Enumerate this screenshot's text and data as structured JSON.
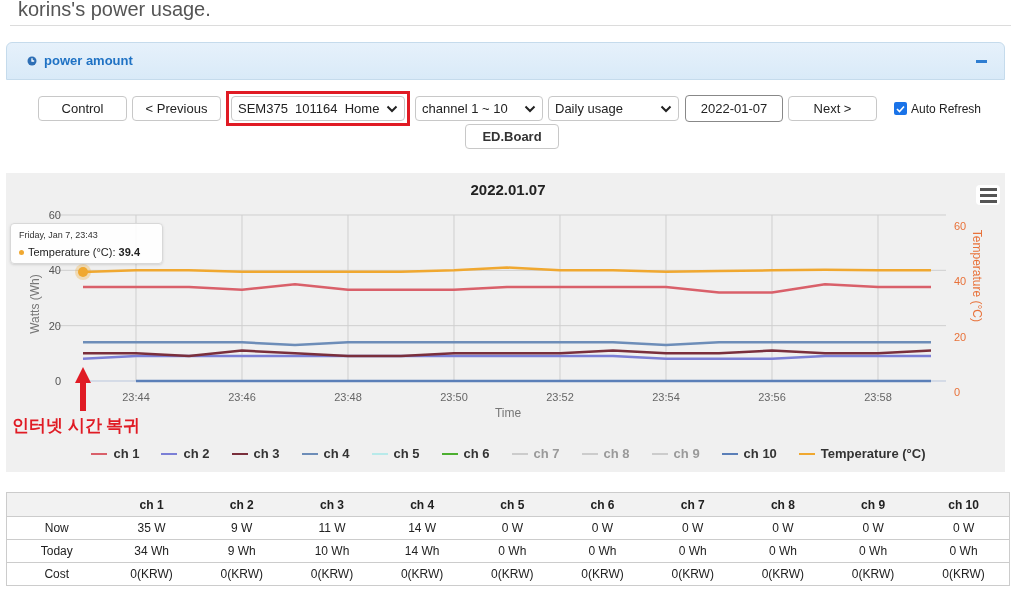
{
  "page_title": "korins's power usage.",
  "panel": {
    "title": "power amount"
  },
  "controls": {
    "control_button": "Control",
    "previous_button": "< Previous",
    "device_select": {
      "value": "SEM375  101164  Home",
      "highlighted": true
    },
    "channel_select": "channel 1 ~ 10",
    "period_select": "Daily usage",
    "date": "2022-01-07",
    "next_button": "Next >",
    "auto_refresh": {
      "label": "Auto Refresh",
      "checked": true
    },
    "board_button": "ED.Board"
  },
  "chart": {
    "chart_data": {
      "type": "line",
      "title": "2022.01.07",
      "xlabel": "Time",
      "ylabel": "Watts (Wh)",
      "y2label": "Temperature (°C)",
      "categories": [
        null,
        "23:44",
        null,
        "23:46",
        null,
        "23:48",
        null,
        "23:50",
        null,
        "23:52",
        null,
        "23:54",
        null,
        "23:56",
        null,
        "23:58",
        null
      ],
      "ylim": [
        0,
        60
      ],
      "yticks": [
        0,
        20,
        40,
        60
      ],
      "y2lim": [
        0,
        60
      ],
      "y2ticks": [
        0,
        20,
        40,
        60
      ],
      "legend": "bottom",
      "series": [
        {
          "name": "ch 1",
          "color": "#d9606a",
          "values": [
            34,
            34,
            34,
            33,
            35,
            33,
            33,
            33,
            34,
            34,
            34,
            34,
            32,
            32,
            35,
            34,
            34
          ]
        },
        {
          "name": "ch 2",
          "color": "#7b7fd6",
          "values": [
            8,
            9,
            9,
            9,
            9,
            9,
            9,
            9,
            9,
            9,
            9,
            8,
            8,
            8,
            9,
            9,
            9
          ]
        },
        {
          "name": "ch 3",
          "color": "#7a2f3c",
          "values": [
            10,
            10,
            9,
            11,
            10,
            9,
            9,
            10,
            10,
            10,
            11,
            10,
            10,
            11,
            10,
            10,
            11
          ]
        },
        {
          "name": "ch 4",
          "color": "#6d8db8",
          "values": [
            14,
            14,
            14,
            14,
            13,
            14,
            14,
            14,
            14,
            14,
            14,
            13,
            14,
            14,
            14,
            14,
            14
          ]
        },
        {
          "name": "ch 5",
          "color": "#b8eaea",
          "values": [
            null,
            null,
            null,
            null,
            null,
            null,
            null,
            null,
            null,
            null,
            null,
            null,
            null,
            null,
            null,
            null,
            null
          ]
        },
        {
          "name": "ch 6",
          "color": "#4caf30",
          "values": [
            null,
            null,
            null,
            null,
            null,
            null,
            null,
            null,
            null,
            null,
            null,
            null,
            null,
            null,
            null,
            null,
            null
          ]
        },
        {
          "name": "ch 7",
          "color": "#cccccc",
          "values": [
            null,
            null,
            null,
            null,
            null,
            null,
            null,
            null,
            null,
            null,
            null,
            null,
            null,
            null,
            null,
            null,
            null
          ]
        },
        {
          "name": "ch 8",
          "color": "#cccccc",
          "values": [
            null,
            null,
            null,
            null,
            null,
            null,
            null,
            null,
            null,
            null,
            null,
            null,
            null,
            null,
            null,
            null,
            null
          ]
        },
        {
          "name": "ch 9",
          "color": "#cccccc",
          "values": [
            null,
            null,
            null,
            null,
            null,
            null,
            null,
            null,
            null,
            null,
            null,
            null,
            null,
            null,
            null,
            null,
            null
          ]
        },
        {
          "name": "ch 10",
          "color": "#5b7fb8",
          "values": [
            null,
            0,
            0,
            0,
            0,
            0,
            0,
            0,
            0,
            0,
            0,
            0,
            0,
            0,
            0,
            0,
            0
          ]
        },
        {
          "name": "Temperature (°C)",
          "color": "#f0a830",
          "values": [
            39.4,
            40,
            40,
            39.5,
            39.5,
            39.5,
            39.5,
            40,
            41,
            40,
            40,
            39.5,
            39.8,
            40,
            40.2,
            40,
            40
          ]
        }
      ]
    },
    "legend_items": [
      {
        "inactive": false
      },
      {
        "inactive": false
      },
      {
        "inactive": false
      },
      {
        "inactive": false
      },
      {
        "inactive": false
      },
      {
        "inactive": false
      },
      {
        "inactive": true
      },
      {
        "inactive": true
      },
      {
        "inactive": true
      },
      {
        "inactive": false
      },
      {
        "inactive": false
      }
    ],
    "tooltip": {
      "time": "Friday, Jan 7, 23:43",
      "text": "Temperature (°C): **39.4**"
    },
    "annotation": "인터넷 시간 복귀"
  },
  "table": {
    "columns": [
      "ch 1",
      "ch 2",
      "ch 3",
      "ch 4",
      "ch 5",
      "ch 6",
      "ch 7",
      "ch 8",
      "ch 9",
      "ch 10"
    ],
    "rows": [
      {
        "label": "Now",
        "cells": [
          "35 W",
          "9 W",
          "11 W",
          "14 W",
          "0 W",
          "0 W",
          "0 W",
          "0 W",
          "0 W",
          "0 W"
        ]
      },
      {
        "label": "Today",
        "cells": [
          "34 Wh",
          "9 Wh",
          "10 Wh",
          "14 Wh",
          "0 Wh",
          "0 Wh",
          "0 Wh",
          "0 Wh",
          "0 Wh",
          "0 Wh"
        ]
      },
      {
        "label": "Cost",
        "cells": [
          "0(KRW)",
          "0(KRW)",
          "0(KRW)",
          "0(KRW)",
          "0(KRW)",
          "0(KRW)",
          "0(KRW)",
          "0(KRW)",
          "0(KRW)",
          "0(KRW)"
        ]
      }
    ]
  }
}
